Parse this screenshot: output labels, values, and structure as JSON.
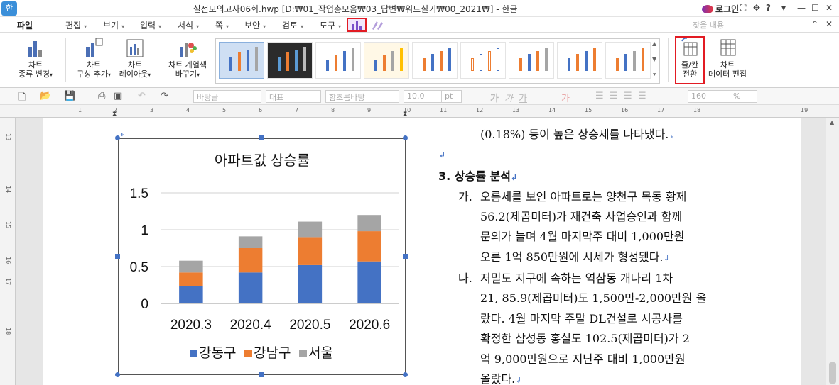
{
  "window": {
    "title": "실전모의고사06회.hwp [D:₩01_작업총모음₩03_답변₩워드실기₩00_2021₩] - 한글",
    "login": "로그인",
    "app_logo": "한"
  },
  "menu": {
    "file": "파일",
    "items": [
      "편집",
      "보기",
      "입력",
      "서식",
      "쪽",
      "보안",
      "검토",
      "도구"
    ],
    "search_placeholder": "찾을 내용"
  },
  "ribbon": {
    "buttons": [
      {
        "line1": "차트",
        "line2": "종류 변경"
      },
      {
        "line1": "차트",
        "line2": "구성 추가"
      },
      {
        "line1": "차트",
        "line2": "레이아웃"
      },
      {
        "line1": "차트 계열색",
        "line2": "바꾸기"
      },
      {
        "line1": "줄/칸",
        "line2": "전환"
      },
      {
        "line1": "차트",
        "line2": "데이터 편집"
      }
    ]
  },
  "format_bar": {
    "style": "바탕글",
    "lang": "대표",
    "font": "함초롬바탕",
    "size": "10.0",
    "unit": "pt",
    "zoom": "160",
    "zoom_unit": "%"
  },
  "ruler_marks": [
    "1",
    "2",
    "3",
    "4",
    "5",
    "6",
    "7",
    "8",
    "9",
    "10",
    "11",
    "12",
    "13",
    "14",
    "15",
    "16",
    "17",
    "18",
    "19"
  ],
  "vruler_marks": [
    "13",
    "14",
    "15",
    "16",
    "17",
    "18"
  ],
  "chart_data": {
    "type": "bar",
    "stacked": true,
    "title": "아파트값 상승률",
    "categories": [
      "2020.3",
      "2020.4",
      "2020.5",
      "2020.6"
    ],
    "series": [
      {
        "name": "강동구",
        "color": "#4472c4",
        "values": [
          0.24,
          0.42,
          0.52,
          0.57
        ]
      },
      {
        "name": "강남구",
        "color": "#ed7d31",
        "values": [
          0.18,
          0.33,
          0.38,
          0.41
        ]
      },
      {
        "name": "서울",
        "color": "#a5a5a5",
        "values": [
          0.16,
          0.16,
          0.21,
          0.22
        ]
      }
    ],
    "yticks": [
      "0",
      "0.5",
      "1",
      "1.5"
    ],
    "ylim": [
      0,
      1.5
    ],
    "grid": true,
    "legend": "bottom"
  },
  "document": {
    "line0": "(0.18%) 등이 높은 상승세를 나타냈다.",
    "heading": "3. 상승률 분석",
    "para_ga": {
      "marker": "가.",
      "lines": [
        "오름세를 보인 아파트로는 양천구 목동 황제",
        "56.2(제곱미터)가 재건축 사업승인과 함께",
        "문의가 늘며 4월 마지막주 대비 1,000만원",
        "오른 1억 850만원에 시세가 형성됐다."
      ]
    },
    "para_na": {
      "marker": "나.",
      "lines": [
        "저밀도 지구에 속하는 역삼동 개나리 1차",
        "21, 85.9(제곱미터)도 1,500만-2,000만원 올",
        "랐다. 4월 마지막 주말 DL건설로 시공사를",
        "확정한 삼성동 홍실도 102.5(제곱미터)가 2",
        "억 9,000만원으로 지난주 대비 1,000만원",
        "올랐다."
      ]
    }
  }
}
